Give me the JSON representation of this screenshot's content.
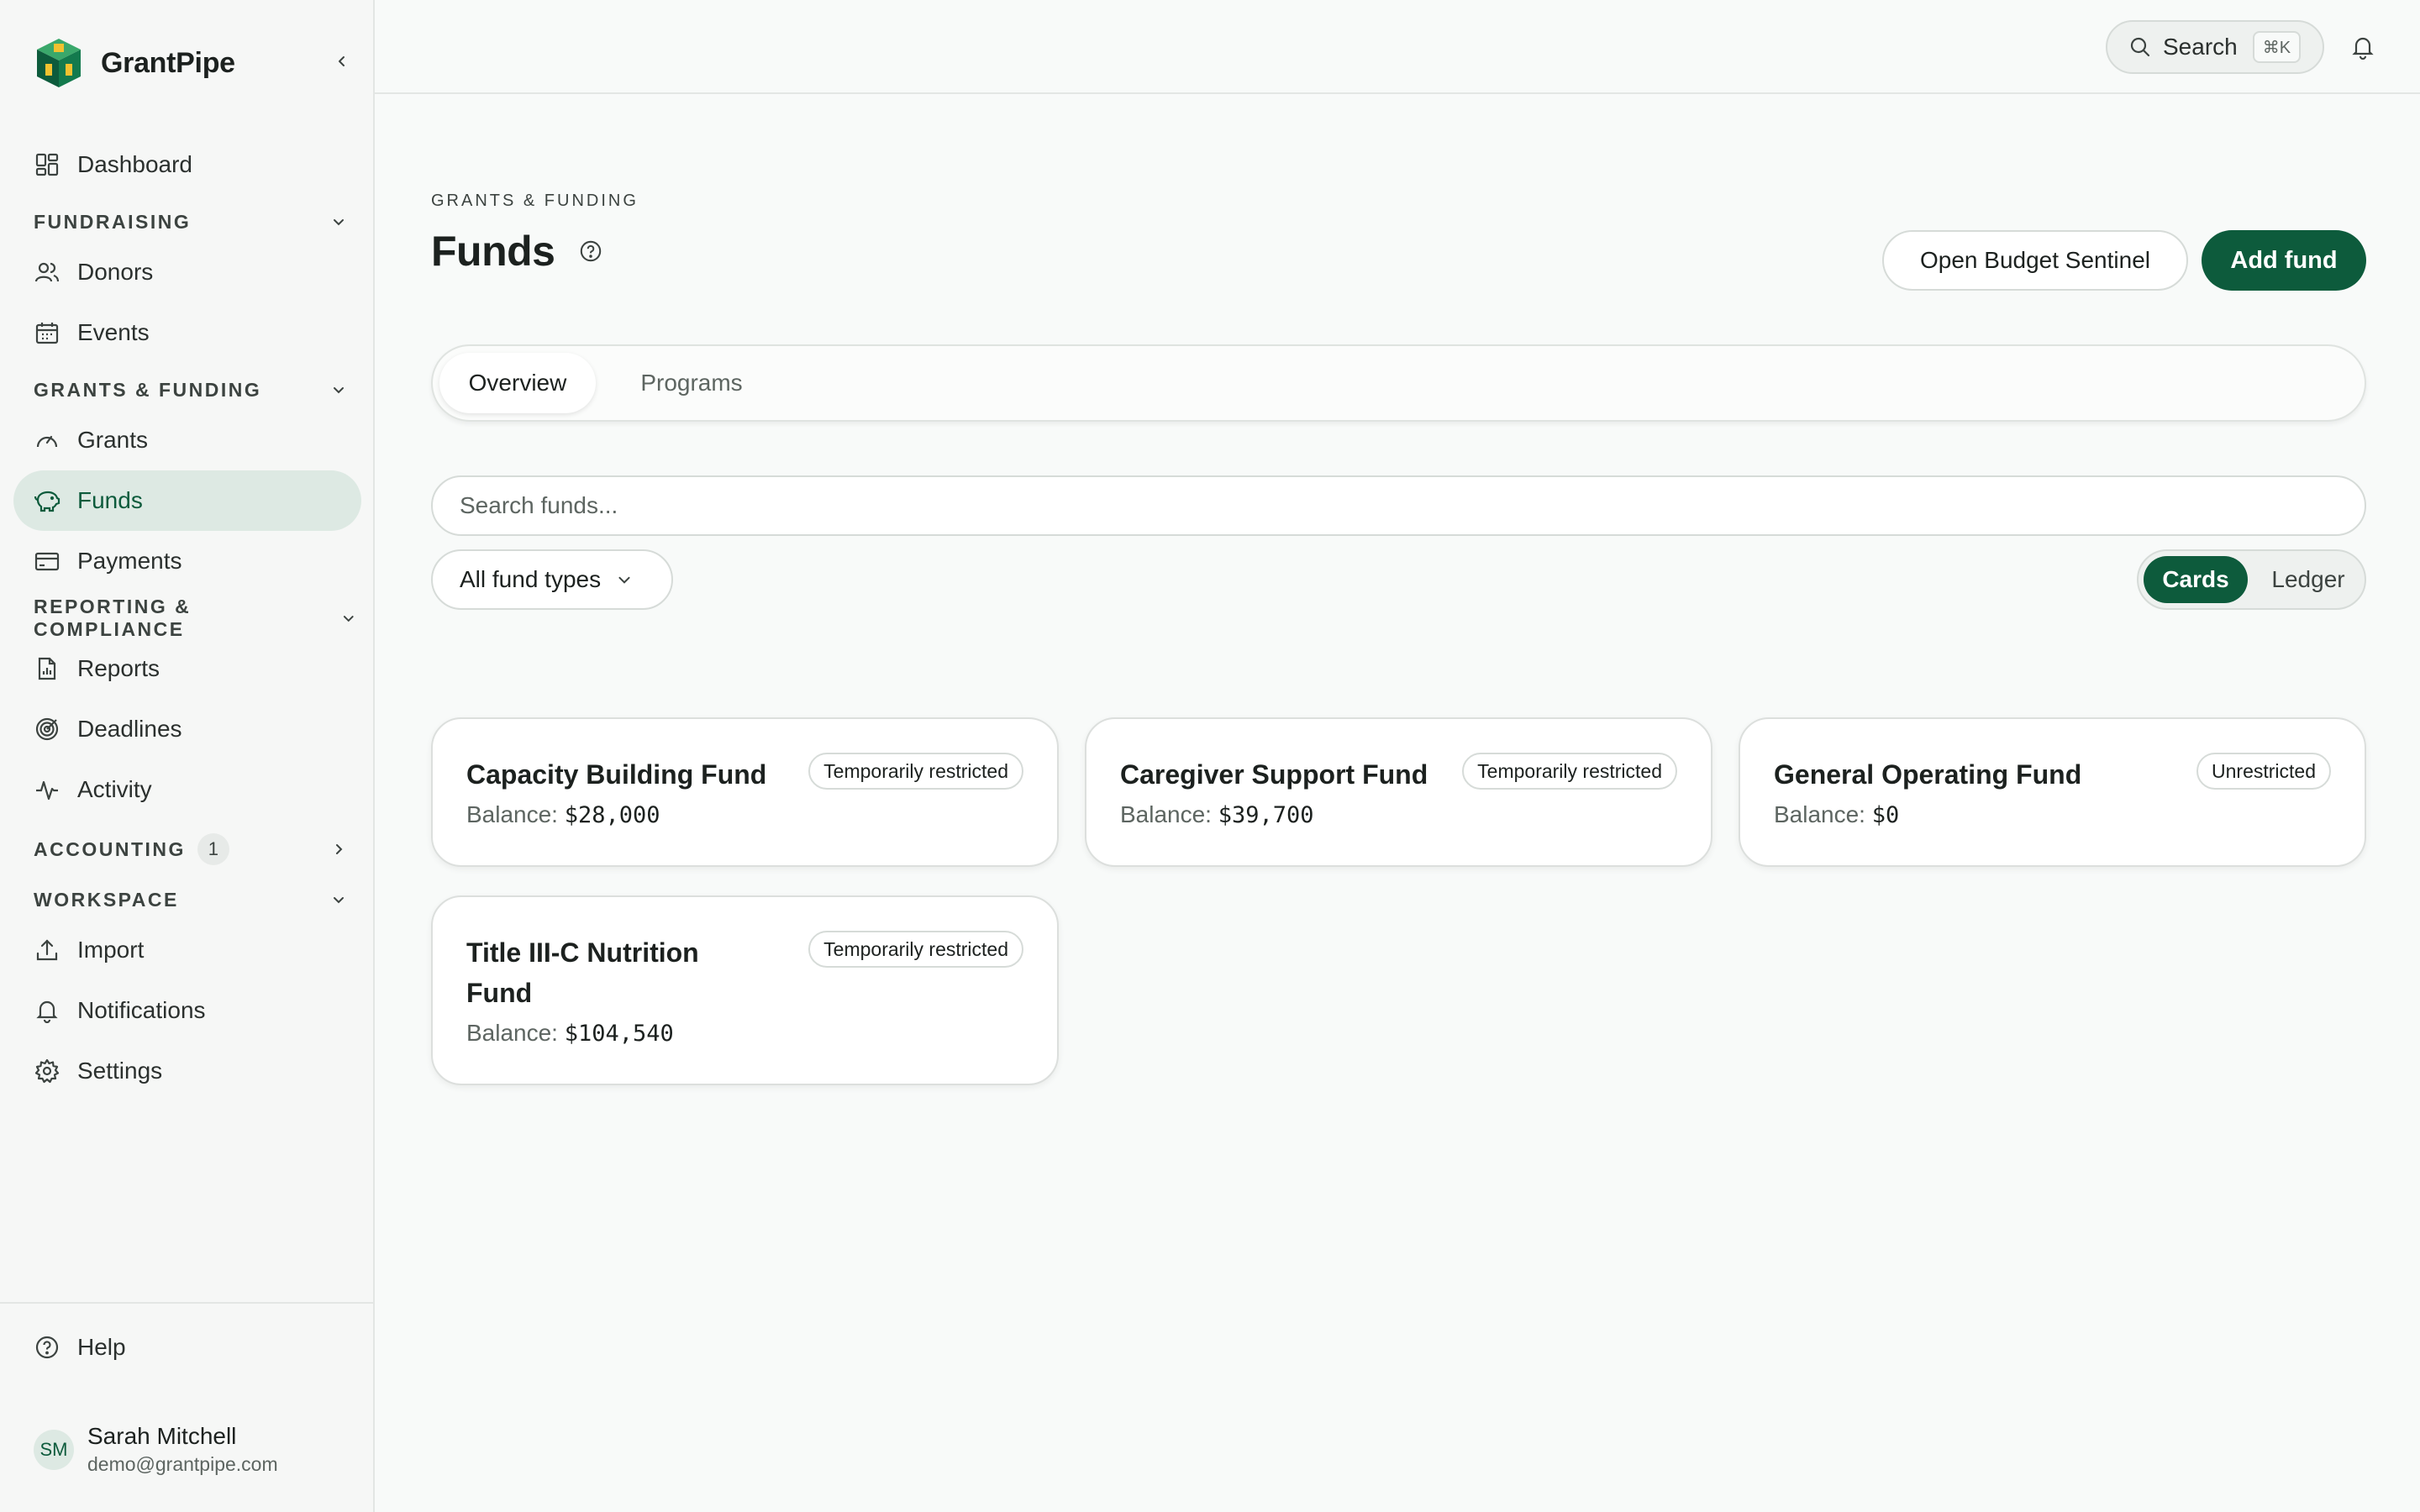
{
  "app": {
    "name": "GrantPipe"
  },
  "sidebar": {
    "items": {
      "dashboard": "Dashboard",
      "donors": "Donors",
      "events": "Events",
      "grants": "Grants",
      "funds": "Funds",
      "payments": "Payments",
      "reports": "Reports",
      "deadlines": "Deadlines",
      "activity": "Activity",
      "import": "Import",
      "notifications": "Notifications",
      "settings": "Settings"
    },
    "sections": {
      "fundraising": "FUNDRAISING",
      "grants_funding": "GRANTS & FUNDING",
      "reporting": "REPORTING & COMPLIANCE",
      "accounting": "ACCOUNTING",
      "accounting_count": "1",
      "workspace": "WORKSPACE"
    },
    "help": "Help",
    "user": {
      "initials": "SM",
      "name": "Sarah Mitchell",
      "email": "demo@grantpipe.com"
    }
  },
  "topbar": {
    "search_label": "Search",
    "shortcut": "⌘K"
  },
  "page": {
    "eyebrow": "GRANTS & FUNDING",
    "title": "Funds",
    "open_budget_label": "Open Budget Sentinel",
    "add_fund_label": "Add fund",
    "tabs": [
      "Overview",
      "Programs"
    ],
    "search_placeholder": "Search funds...",
    "filter_label": "All fund types",
    "view_options": [
      "Cards",
      "Ledger"
    ],
    "balance_label": "Balance:"
  },
  "funds": [
    {
      "name": "Capacity Building Fund",
      "badge": "Temporarily restricted",
      "balance": "$28,000"
    },
    {
      "name": "Caregiver Support Fund",
      "badge": "Temporarily restricted",
      "balance": "$39,700"
    },
    {
      "name": "General Operating Fund",
      "badge": "Unrestricted",
      "balance": "$0"
    },
    {
      "name": "Title III-C Nutrition Fund",
      "badge": "Temporarily restricted",
      "balance": "$104,540"
    }
  ],
  "colors": {
    "accent": "#0d5b3c",
    "active_bg": "#dde9e3"
  }
}
